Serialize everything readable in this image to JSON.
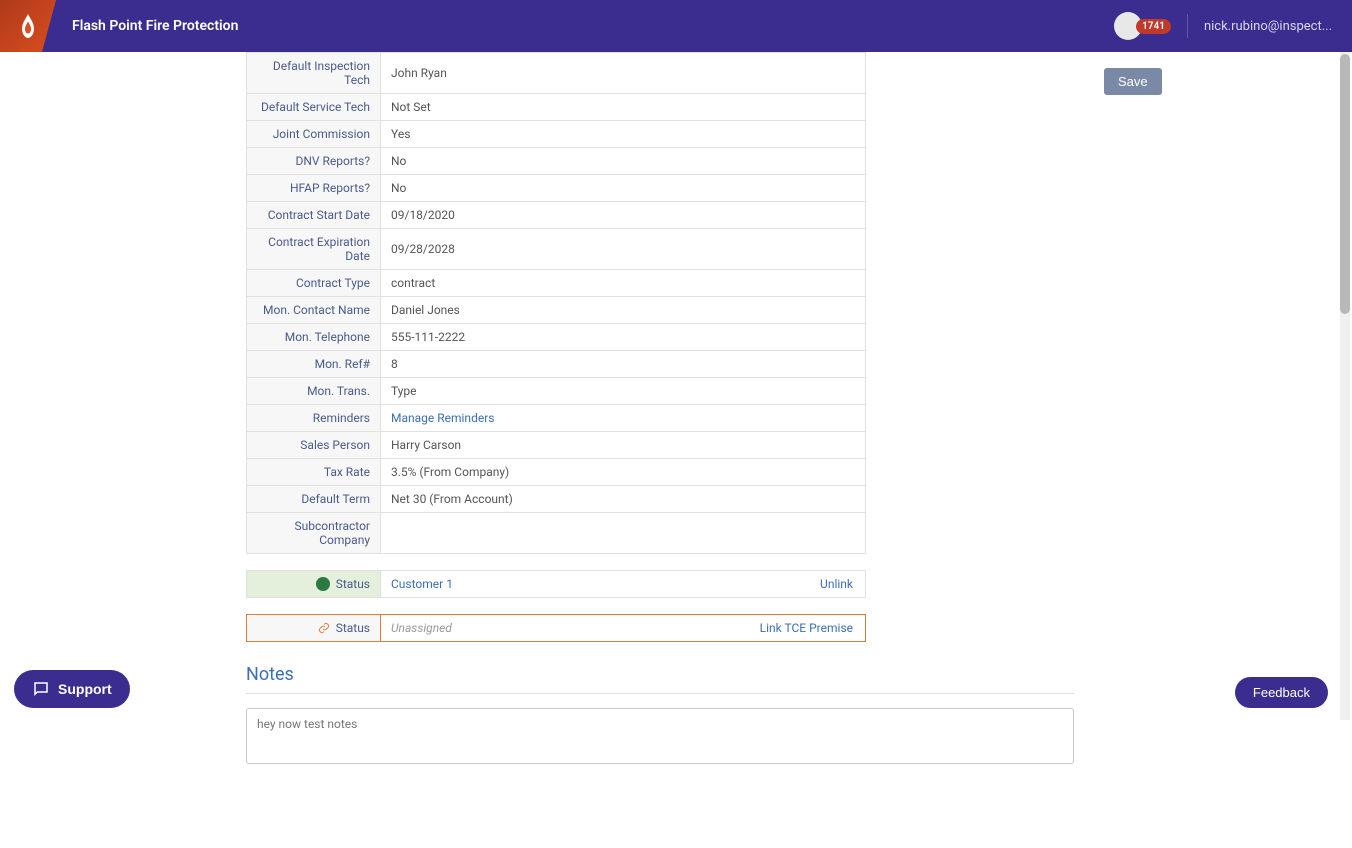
{
  "header": {
    "app_name": "Flash Point Fire Protection",
    "badge_count": "1741",
    "user_email": "nick.rubino@inspect..."
  },
  "save_label": "Save",
  "rows": [
    {
      "label": "Default Inspection Tech",
      "value": "John Ryan",
      "link": false
    },
    {
      "label": "Default Service Tech",
      "value": "Not Set",
      "link": false
    },
    {
      "label": "Joint Commission",
      "value": "Yes",
      "link": false
    },
    {
      "label": "DNV Reports?",
      "value": "No",
      "link": false
    },
    {
      "label": "HFAP Reports?",
      "value": "No",
      "link": false
    },
    {
      "label": "Contract Start Date",
      "value": "09/18/2020",
      "link": false
    },
    {
      "label": "Contract Expiration Date",
      "value": "09/28/2028",
      "link": false
    },
    {
      "label": "Contract Type",
      "value": "contract",
      "link": false
    },
    {
      "label": "Mon. Contact Name",
      "value": "Daniel Jones",
      "link": false
    },
    {
      "label": "Mon. Telephone",
      "value": "555-111-2222",
      "link": false
    },
    {
      "label": "Mon. Ref#",
      "value": "8",
      "link": false
    },
    {
      "label": "Mon. Trans.",
      "value": "Type",
      "link": false
    },
    {
      "label": "Reminders",
      "value": "Manage Reminders",
      "link": true
    },
    {
      "label": "Sales Person",
      "value": "Harry Carson",
      "link": false
    },
    {
      "label": "Tax Rate",
      "value": "3.5% (From Company)",
      "link": false
    },
    {
      "label": "Default Term",
      "value": "Net 30 (From Account)",
      "link": false
    },
    {
      "label": "Subcontractor Company",
      "value": "",
      "link": false
    }
  ],
  "status1": {
    "label": "Status",
    "value": "Customer 1",
    "action": "Unlink"
  },
  "status2": {
    "label": "Status",
    "value": "Unassigned",
    "action": "Link TCE Premise"
  },
  "notes": {
    "title": "Notes",
    "content": "hey now test notes"
  },
  "support_label": "Support",
  "feedback_label": "Feedback"
}
